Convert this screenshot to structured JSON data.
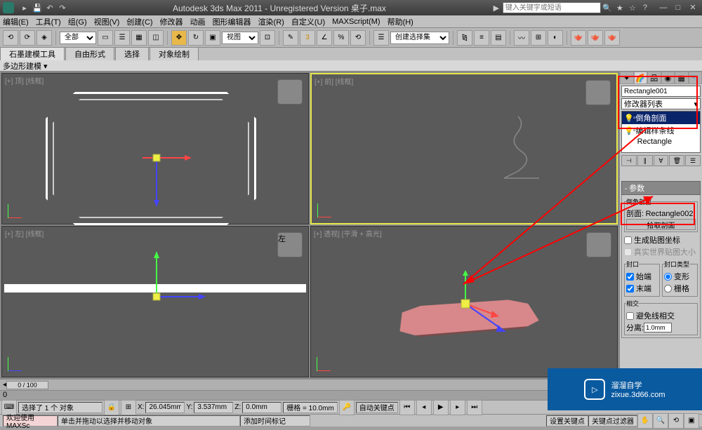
{
  "titlebar": {
    "app_title": "Autodesk 3ds Max 2011 - Unregistered Version   桌子.max",
    "search_placeholder": "键入关键字或短语"
  },
  "menus": [
    "编辑(E)",
    "工具(T)",
    "组(G)",
    "视图(V)",
    "创建(C)",
    "修改器",
    "动画",
    "图形编辑器",
    "渲染(R)",
    "自定义(U)",
    "MAXScript(M)",
    "帮助(H)"
  ],
  "toolbar1": {
    "combo_all": "全部",
    "combo_view": "视图",
    "combo_seset": "创建选择集"
  },
  "tabs": [
    "石墨建模工具",
    "自由形式",
    "选择",
    "对象绘制"
  ],
  "subtab": "多边形建模",
  "viewports": {
    "top": "[+] 顶] [线框]",
    "front": "[+] 前] [线框]",
    "left": "[+] 左] [线框]",
    "persp": "[+] 透视] [平滑 + 高光]"
  },
  "cmdpanel": {
    "object_name": "Rectangle001",
    "modlist_label": "修改器列表",
    "stack": [
      {
        "name": "倒角剖面",
        "sel": true
      },
      {
        "name": "编辑样条线",
        "sel": false
      },
      {
        "name": "Rectangle",
        "sel": false
      }
    ],
    "roll_params": "参数",
    "roll_bevelprofile": "倒角剖面",
    "profile_label": "剖面:",
    "profile_value": "Rectangle002",
    "pick_profile": "拾取剖面",
    "gen_map": "生成贴图坐标",
    "real_world": "真实世界贴图大小",
    "cap_group": "封口",
    "cap_start": "始端",
    "cap_end": "末端",
    "cap_type_group": "封口类型",
    "cap_morph": "变形",
    "cap_grid": "栅格",
    "intersect_group": "相交",
    "avoid_intersect": "避免线相交",
    "separation_label": "分离:",
    "separation_value": "1.0mm"
  },
  "timeline": {
    "slider": "0 / 100",
    "marks": "0"
  },
  "status": {
    "selected": "选择了 1 个 对象",
    "x_label": "X:",
    "x_val": "26.045mm",
    "y_label": "Y:",
    "y_val": "3.537mm",
    "z_label": "Z:",
    "z_val": "0.0mm",
    "grid_label": "栅格 = 10.0mm",
    "autokey": "自动关键点",
    "setkey": "设置关键点",
    "keyfilter": "关键点过滤器",
    "add_time_tag": "添加时间标记"
  },
  "prompt": {
    "welcome": "欢迎使用 MAXSc",
    "hint": "单击并拖动以选择并移动对象"
  },
  "watermark": {
    "text": "溜溜自学",
    "url": "zixue.3d66.com"
  }
}
